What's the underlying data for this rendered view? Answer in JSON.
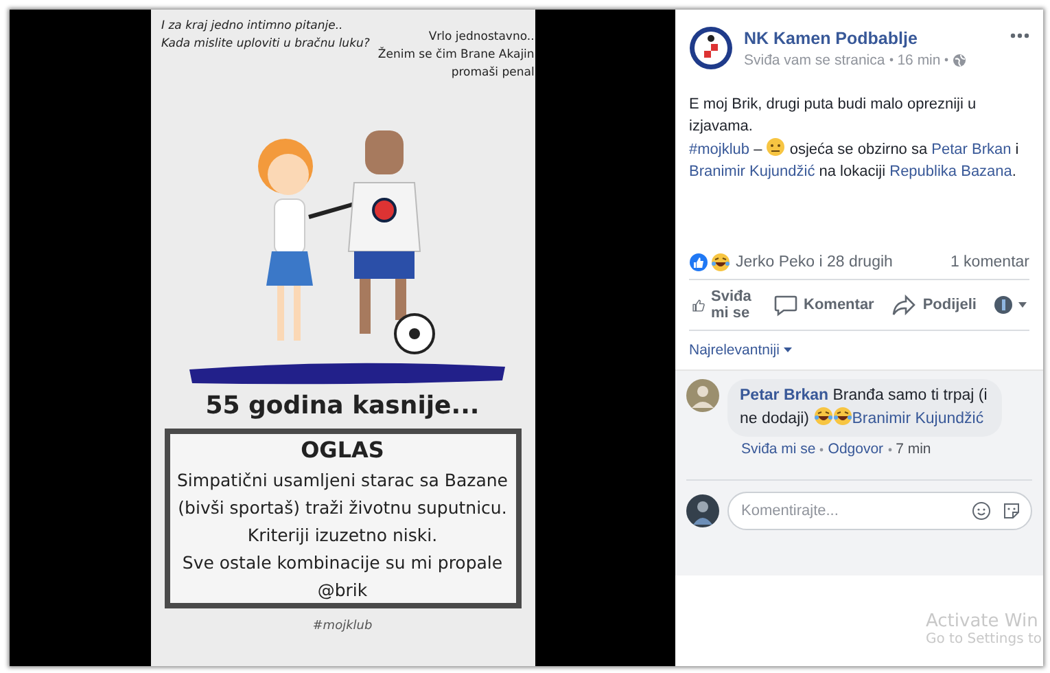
{
  "posted_image": {
    "question": [
      "I za kraj jedno intimno pitanje..",
      "Kada mislite uploviti u bračnu luku?"
    ],
    "answer": [
      "Vrlo jednostavno..",
      "Ženim se čim Brane Akajin",
      "promaši penal"
    ],
    "caption": "55 godina kasnije...",
    "ad": {
      "title": "OGLAS",
      "lines": [
        "Simpatični usamljeni starac sa Bazane",
        "(bivši sportaš) traži životnu suputnicu.",
        "Kriteriji izuzetno niski.",
        "Sve ostale kombinacije su mi propale",
        "@brik"
      ]
    },
    "hashtag": "#mojklub"
  },
  "post": {
    "page_name": "NK Kamen Podbablje",
    "subtitle": "Sviđa vam se stranica",
    "time": "16 min",
    "paragraphs": [
      [
        {
          "kind": "text",
          "text": "E moj Brik, drugi puta budi malo oprezniji u izjavama."
        }
      ],
      [
        {
          "kind": "link",
          "text": "#mojklub"
        },
        {
          "kind": "text",
          "text": " – "
        },
        {
          "kind": "emoji"
        },
        {
          "kind": "text",
          "text": " osjeća se obzirno sa "
        },
        {
          "kind": "link",
          "text": "Petar Brkan"
        },
        {
          "kind": "text",
          "text": " i "
        },
        {
          "kind": "link",
          "text": "Branimir Kujundžić"
        },
        {
          "kind": "text",
          "text": " na lokaciji "
        },
        {
          "kind": "link",
          "text": "Republika Bazana"
        },
        {
          "kind": "text",
          "text": "."
        }
      ]
    ]
  },
  "reactions": {
    "summary": "Jerko Peko i 28 drugih",
    "comments": "1 komentar"
  },
  "actions": [
    {
      "kind": "like",
      "label": "Sviđa mi se"
    },
    {
      "kind": "comment",
      "label": "Komentar"
    },
    {
      "kind": "share",
      "label": "Podijeli"
    },
    {
      "kind": "audience"
    }
  ],
  "sort": "Najrelevantniji",
  "comment": {
    "author": "Petar Brkan",
    "text": "Branđa samo ti trpaj (i ne dodaji)",
    "mention": "Branimir Kujundžić",
    "actions": [
      "Sviđa mi se",
      "Odgovor",
      "7 min"
    ]
  },
  "composer": {
    "placeholder": "Komentirajte..."
  },
  "activation": [
    "Activate Win",
    "Go to Settings to"
  ]
}
